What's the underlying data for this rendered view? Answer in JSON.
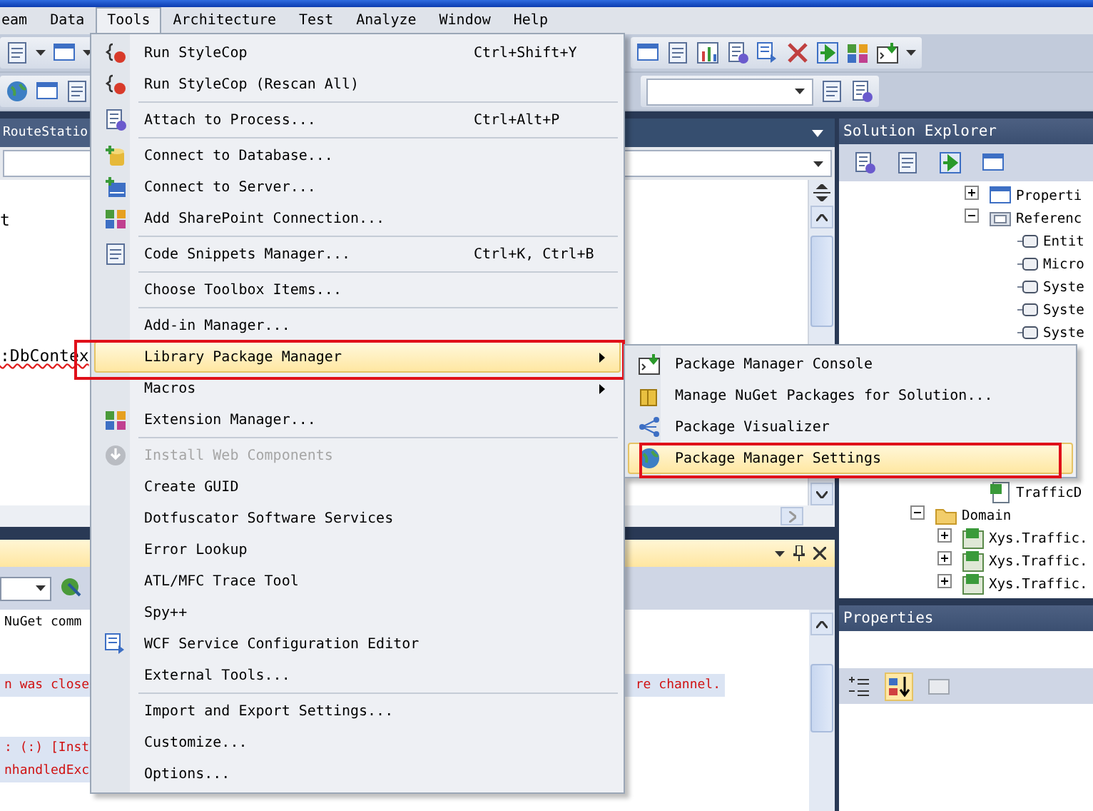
{
  "menubar": [
    {
      "label": "eam",
      "selected": false
    },
    {
      "label": "Data",
      "selected": false
    },
    {
      "label": "Tools",
      "selected": true
    },
    {
      "label": "Architecture",
      "selected": false
    },
    {
      "label": "Test",
      "selected": false
    },
    {
      "label": "Analyze",
      "selected": false
    },
    {
      "label": "Window",
      "selected": false
    },
    {
      "label": "Help",
      "selected": false
    }
  ],
  "editor": {
    "tab": "RouteStatio",
    "lines": [
      {
        "text": "t",
        "error": false
      },
      {
        "text": ":DbContex",
        "error": true
      }
    ]
  },
  "output": {
    "lines": [
      {
        "text": "NuGet comm",
        "kind": "info"
      },
      {
        "text": "n was close",
        "tail": "re channel.",
        "kind": "error"
      },
      {
        "text": ": (:) [Inst",
        "kind": "error"
      },
      {
        "text": "nhandledExc",
        "kind": "error"
      }
    ]
  },
  "solution_explorer": {
    "title": "Solution Explorer",
    "tree": [
      {
        "children": [
          {
            "children": [
              {
                "label": "Properti",
                "kind": "properties",
                "expanded": false
              },
              {
                "label": "Referenc",
                "kind": "references",
                "expanded": true,
                "children": [
                  {
                    "label": "Entit",
                    "kind": "assembly"
                  },
                  {
                    "label": "Micro",
                    "kind": "assembly"
                  },
                  {
                    "label": "Syste",
                    "kind": "assembly"
                  },
                  {
                    "label": "Syste",
                    "kind": "assembly"
                  },
                  {
                    "label": "Syste",
                    "kind": "assembly"
                  }
                ]
              },
              {
                "label": "TrafficD",
                "kind": "file"
              }
            ]
          }
        ]
      },
      {
        "label": "Domain",
        "kind": "folder",
        "expanded": true,
        "children": [
          {
            "label": "Xys.Traffic.",
            "kind": "project",
            "expanded": false
          },
          {
            "label": "Xys.Traffic.",
            "kind": "project",
            "expanded": false
          },
          {
            "label": "Xys.Traffic.",
            "kind": "project",
            "expanded": false
          }
        ]
      }
    ]
  },
  "properties": {
    "title": "Properties"
  },
  "tools_menu": {
    "groups": [
      [
        {
          "label": "Run StyleCop",
          "shortcut": "Ctrl+Shift+Y",
          "icon": true,
          "selected": false,
          "disabled": false,
          "submenu": false,
          "annotated": false
        },
        {
          "label": "Run StyleCop (Rescan All)",
          "icon": true,
          "selected": false,
          "disabled": false,
          "submenu": false,
          "annotated": false
        }
      ],
      [
        {
          "label": "Attach to Process...",
          "shortcut": "Ctrl+Alt+P",
          "icon": true,
          "selected": false,
          "disabled": false,
          "submenu": false,
          "annotated": false
        }
      ],
      [
        {
          "label": "Connect to Database...",
          "icon": true,
          "selected": false,
          "disabled": false,
          "submenu": false,
          "annotated": false
        },
        {
          "label": "Connect to Server...",
          "icon": true,
          "selected": false,
          "disabled": false,
          "submenu": false,
          "annotated": false
        },
        {
          "label": "Add SharePoint Connection...",
          "icon": true,
          "selected": false,
          "disabled": false,
          "submenu": false,
          "annotated": false
        }
      ],
      [
        {
          "label": "Code Snippets Manager...",
          "shortcut": "Ctrl+K, Ctrl+B",
          "icon": true,
          "selected": false,
          "disabled": false,
          "submenu": false,
          "annotated": false
        }
      ],
      [
        {
          "label": "Choose Toolbox Items...",
          "icon": false,
          "selected": false,
          "disabled": false,
          "submenu": false,
          "annotated": false
        }
      ],
      [
        {
          "label": "Add-in Manager...",
          "icon": false,
          "selected": false,
          "disabled": false,
          "submenu": false,
          "annotated": false
        },
        {
          "label": "Library Package Manager",
          "icon": false,
          "selected": true,
          "disabled": false,
          "submenu": true,
          "annotated": true
        },
        {
          "label": "Macros",
          "icon": false,
          "selected": false,
          "disabled": false,
          "submenu": true,
          "annotated": false
        },
        {
          "label": "Extension Manager...",
          "icon": true,
          "selected": false,
          "disabled": false,
          "submenu": false,
          "annotated": false
        }
      ],
      [
        {
          "label": "Install Web Components",
          "icon": true,
          "selected": false,
          "disabled": true,
          "submenu": false,
          "annotated": false
        },
        {
          "label": "Create GUID",
          "icon": false,
          "selected": false,
          "disabled": false,
          "submenu": false,
          "annotated": false
        },
        {
          "label": "Dotfuscator Software Services",
          "icon": false,
          "selected": false,
          "disabled": false,
          "submenu": false,
          "annotated": false
        },
        {
          "label": "Error Lookup",
          "icon": false,
          "selected": false,
          "disabled": false,
          "submenu": false,
          "annotated": false
        },
        {
          "label": "ATL/MFC Trace Tool",
          "icon": false,
          "selected": false,
          "disabled": false,
          "submenu": false,
          "annotated": false
        },
        {
          "label": "Spy++",
          "icon": false,
          "selected": false,
          "disabled": false,
          "submenu": false,
          "annotated": false
        },
        {
          "label": "WCF Service Configuration Editor",
          "icon": true,
          "selected": false,
          "disabled": false,
          "submenu": false,
          "annotated": false
        },
        {
          "label": "External Tools...",
          "icon": false,
          "selected": false,
          "disabled": false,
          "submenu": false,
          "annotated": false
        }
      ],
      [
        {
          "label": "Import and Export Settings...",
          "icon": false,
          "selected": false,
          "disabled": false,
          "submenu": false,
          "annotated": false
        },
        {
          "label": "Customize...",
          "icon": false,
          "selected": false,
          "disabled": false,
          "submenu": false,
          "annotated": false
        },
        {
          "label": "Options...",
          "icon": false,
          "selected": false,
          "disabled": false,
          "submenu": false,
          "annotated": false
        }
      ]
    ]
  },
  "package_submenu": {
    "items": [
      {
        "label": "Package Manager Console",
        "selected": false,
        "annotated": false
      },
      {
        "label": "Manage NuGet Packages for Solution...",
        "selected": false,
        "annotated": false
      },
      {
        "label": "Package Visualizer",
        "selected": false,
        "annotated": false
      },
      {
        "label": "Package Manager Settings",
        "selected": true,
        "annotated": true
      }
    ]
  }
}
